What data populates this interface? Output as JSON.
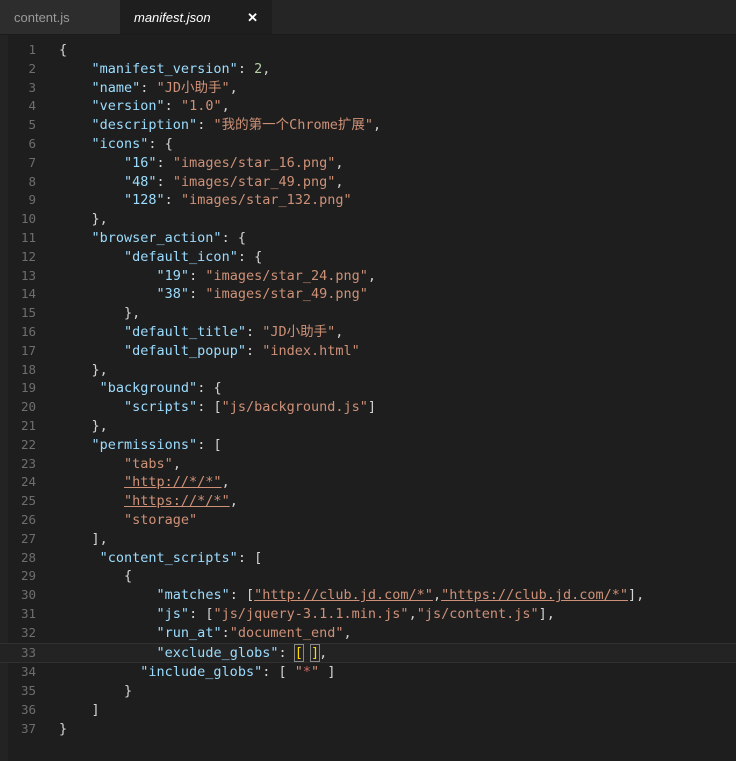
{
  "window": {
    "app": "code-editor",
    "background_color": "#1e1e1e"
  },
  "tabbar": {
    "tabs": [
      {
        "label": "content.js",
        "active": false,
        "closeable": false
      },
      {
        "label": "manifest.json",
        "active": true,
        "closeable": true,
        "close_label": "✕"
      }
    ]
  },
  "editor": {
    "language": "json",
    "current_line": 33,
    "total_lines": 37,
    "colors": {
      "background": "#1e1e1e",
      "gutter_text": "#6e6e6e",
      "default_text": "#d4d4d4",
      "key": "#9cdcfe",
      "string": "#ce9178",
      "number": "#b5cea8",
      "current_line_bg": "#232323",
      "tabbar_bg": "#252526",
      "inactive_tab_bg": "#2d2d2d"
    },
    "lines": [
      {
        "n": 1,
        "text": "{"
      },
      {
        "n": 2,
        "text": "    \"manifest_version\": 2,"
      },
      {
        "n": 3,
        "text": "    \"name\": \"JD小助手\","
      },
      {
        "n": 4,
        "text": "    \"version\": \"1.0\","
      },
      {
        "n": 5,
        "text": "    \"description\": \"我的第一个Chrome扩展\","
      },
      {
        "n": 6,
        "text": "    \"icons\": {"
      },
      {
        "n": 7,
        "text": "        \"16\": \"images/star_16.png\","
      },
      {
        "n": 8,
        "text": "        \"48\": \"images/star_49.png\","
      },
      {
        "n": 9,
        "text": "        \"128\": \"images/star_132.png\""
      },
      {
        "n": 10,
        "text": "    },"
      },
      {
        "n": 11,
        "text": "    \"browser_action\": {"
      },
      {
        "n": 12,
        "text": "        \"default_icon\": {"
      },
      {
        "n": 13,
        "text": "            \"19\": \"images/star_24.png\","
      },
      {
        "n": 14,
        "text": "            \"38\": \"images/star_49.png\""
      },
      {
        "n": 15,
        "text": "        },"
      },
      {
        "n": 16,
        "text": "        \"default_title\": \"JD小助手\","
      },
      {
        "n": 17,
        "text": "        \"default_popup\": \"index.html\""
      },
      {
        "n": 18,
        "text": "    },"
      },
      {
        "n": 19,
        "text": "     \"background\": {"
      },
      {
        "n": 20,
        "text": "        \"scripts\": [\"js/background.js\"]"
      },
      {
        "n": 21,
        "text": "    },"
      },
      {
        "n": 22,
        "text": "    \"permissions\": ["
      },
      {
        "n": 23,
        "text": "        \"tabs\","
      },
      {
        "n": 24,
        "text": "        \"http://*/*\","
      },
      {
        "n": 25,
        "text": "        \"https://*/*\","
      },
      {
        "n": 26,
        "text": "        \"storage\""
      },
      {
        "n": 27,
        "text": "    ],"
      },
      {
        "n": 28,
        "text": "     \"content_scripts\": ["
      },
      {
        "n": 29,
        "text": "        {"
      },
      {
        "n": 30,
        "text": "            \"matches\": [\"http://club.jd.com/*\",\"https://club.jd.com/*\"],"
      },
      {
        "n": 31,
        "text": "            \"js\": [\"js/jquery-3.1.1.min.js\",\"js/content.js\"],"
      },
      {
        "n": 32,
        "text": "            \"run_at\":\"document_end\","
      },
      {
        "n": 33,
        "text": "            \"exclude_globs\": [ ],"
      },
      {
        "n": 34,
        "text": "          \"include_globs\": [ \"*\" ]"
      },
      {
        "n": 35,
        "text": "        }"
      },
      {
        "n": 36,
        "text": "    ]"
      },
      {
        "n": 37,
        "text": "}"
      }
    ]
  }
}
